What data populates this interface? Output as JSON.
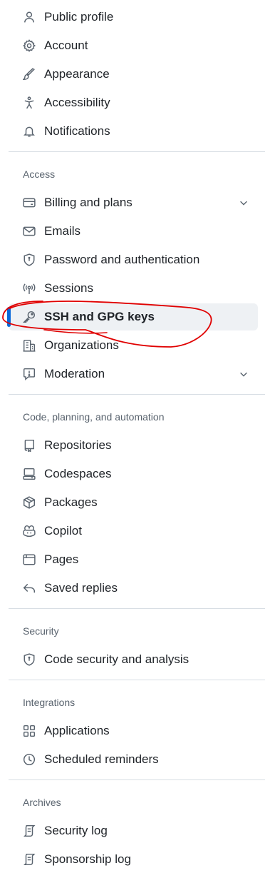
{
  "nav": {
    "items_top": [
      {
        "label": "Public profile",
        "icon": "person-icon"
      },
      {
        "label": "Account",
        "icon": "gear-icon"
      },
      {
        "label": "Appearance",
        "icon": "paintbrush-icon"
      },
      {
        "label": "Accessibility",
        "icon": "accessibility-icon"
      },
      {
        "label": "Notifications",
        "icon": "bell-icon"
      }
    ],
    "sections": [
      {
        "heading": "Access",
        "items": [
          {
            "label": "Billing and plans",
            "icon": "credit-card-icon",
            "expandable": true
          },
          {
            "label": "Emails",
            "icon": "mail-icon"
          },
          {
            "label": "Password and authentication",
            "icon": "shield-lock-icon"
          },
          {
            "label": "Sessions",
            "icon": "broadcast-icon"
          },
          {
            "label": "SSH and GPG keys",
            "icon": "key-icon",
            "active": true
          },
          {
            "label": "Organizations",
            "icon": "organization-icon"
          },
          {
            "label": "Moderation",
            "icon": "report-icon",
            "expandable": true
          }
        ]
      },
      {
        "heading": "Code, planning, and automation",
        "items": [
          {
            "label": "Repositories",
            "icon": "repo-icon"
          },
          {
            "label": "Codespaces",
            "icon": "codespaces-icon"
          },
          {
            "label": "Packages",
            "icon": "package-icon"
          },
          {
            "label": "Copilot",
            "icon": "copilot-icon"
          },
          {
            "label": "Pages",
            "icon": "browser-icon"
          },
          {
            "label": "Saved replies",
            "icon": "reply-icon"
          }
        ]
      },
      {
        "heading": "Security",
        "items": [
          {
            "label": "Code security and analysis",
            "icon": "shield-lock-icon"
          }
        ]
      },
      {
        "heading": "Integrations",
        "items": [
          {
            "label": "Applications",
            "icon": "apps-icon"
          },
          {
            "label": "Scheduled reminders",
            "icon": "clock-icon"
          }
        ]
      },
      {
        "heading": "Archives",
        "items": [
          {
            "label": "Security log",
            "icon": "log-icon"
          },
          {
            "label": "Sponsorship log",
            "icon": "log-icon"
          }
        ]
      }
    ]
  },
  "colors": {
    "accent": "#0969da",
    "annotation": "#e00000",
    "active_bg": "#eef1f4"
  }
}
